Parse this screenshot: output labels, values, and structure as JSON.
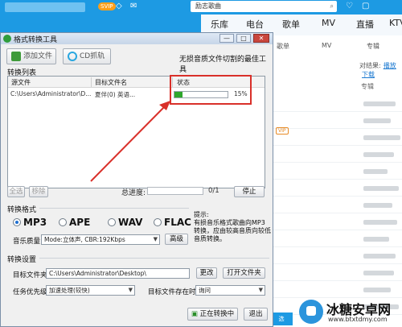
{
  "background_app": {
    "search_text": "励志歌曲",
    "vip_badge": "SVIP",
    "nav": [
      "乐库",
      "电台",
      "歌单",
      "MV",
      "直播",
      "KTV"
    ],
    "sub_nav": [
      "歌单",
      "MV",
      "专辑"
    ],
    "result_label": "对结果:",
    "result_links": [
      "播放",
      "下载"
    ],
    "column_album": "专辑",
    "vip_tag": "VIP",
    "bottom_button": "选"
  },
  "dialog": {
    "title": "格式转换工具",
    "win_buttons": [
      "—",
      "□",
      "✕"
    ],
    "toolbar": {
      "add_file": "添加文件",
      "cd_grab": "CD抓轨",
      "tagline": "无损音质文件切割的最佳工具"
    },
    "list_section": "转换列表",
    "columns": [
      "源文件",
      "目标文件名",
      "状态"
    ],
    "rows": [
      {
        "source": "C:\\Users\\Administrator\\D...",
        "target": "夏伴(0) 英语...",
        "percent": "15%",
        "progress": 0.15
      }
    ],
    "buttons": {
      "select_all": "全选",
      "remove": "移除",
      "stop": "停止"
    },
    "total_progress_label": "总进度:",
    "total_count": "0/1",
    "format_section": "转换格式",
    "formats": [
      {
        "label": "MP3",
        "selected": true
      },
      {
        "label": "APE",
        "selected": false
      },
      {
        "label": "WAV",
        "selected": false
      },
      {
        "label": "FLAC",
        "selected": false
      }
    ],
    "hint": "提示:\n有损音乐格式歌曲向MP3转换，应由较高音质向较低音质转换。",
    "quality_label": "音乐质量",
    "quality_value": "Mode:立体声, CBR:192Kbps",
    "advanced_button": "高级",
    "settings_section": "转换设置",
    "target_folder_label": "目标文件夹",
    "target_folder_value": "C:\\Users\\Administrator\\Desktop\\",
    "change_button": "更改",
    "open_folder_button": "打开文件夹",
    "priority_label": "任务优先级",
    "priority_value": "加速处理(较快)",
    "exists_label": "目标文件存在时",
    "exists_value": "询问",
    "converting_button": "正在转换中",
    "exit_button": "退出"
  },
  "watermark": {
    "name": "冰糖安卓网",
    "url": "www.btxtdmy.com"
  }
}
